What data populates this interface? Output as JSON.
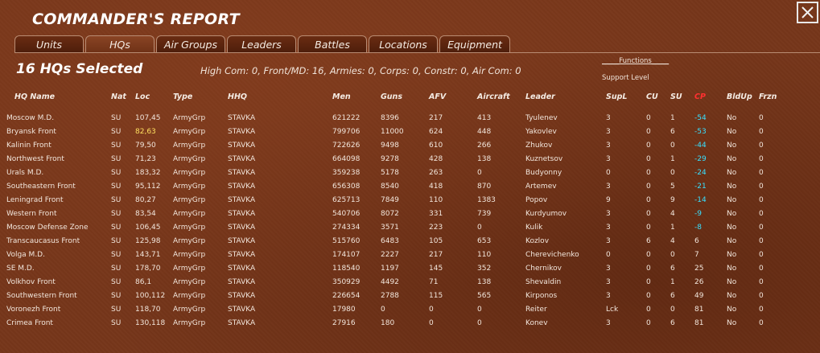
{
  "window": {
    "title": "COMMANDER'S REPORT",
    "close_label": "✕"
  },
  "tabs": [
    {
      "label": "Units",
      "active": false
    },
    {
      "label": "HQs",
      "active": true
    },
    {
      "label": "Air Groups",
      "active": false
    },
    {
      "label": "Leaders",
      "active": false
    },
    {
      "label": "Battles",
      "active": false
    },
    {
      "label": "Locations",
      "active": false
    },
    {
      "label": "Equipment",
      "active": false
    }
  ],
  "selection": {
    "title": "16 HQs Selected",
    "summary": "High Com: 0, Front/MD: 16, Armies: 0, Corps: 0, Constr: 0, Air Com: 0",
    "functions_label": "_____Functions_____",
    "support_level_label": "Support Level"
  },
  "columns": [
    "HQ Name",
    "Nat",
    "Loc",
    "Type",
    "HHQ",
    "Men",
    "Guns",
    "AFV",
    "Aircraft",
    "Leader",
    "SupL",
    "CU",
    "SU",
    "CP",
    "BldUp",
    "Frzn"
  ],
  "colors": {
    "cp_header": "#ff3030",
    "cp_negative": "#38e0ff",
    "highlight_loc": "#ffe060"
  },
  "rows": [
    {
      "name": "Moscow M.D.",
      "nat": "SU",
      "loc": "107,45",
      "type": "ArmyGrp",
      "hhq": "STAVKA",
      "men": "621222",
      "guns": "8396",
      "afv": "217",
      "aircraft": "413",
      "leader": "Tyulenev",
      "supl": "3",
      "cu": "0",
      "su": "1",
      "cp": "-54",
      "bldup": "No",
      "frzn": "0"
    },
    {
      "name": "Bryansk Front",
      "nat": "SU",
      "loc": "82,63",
      "loc_highlight": true,
      "type": "ArmyGrp",
      "hhq": "STAVKA",
      "men": "799706",
      "guns": "11000",
      "afv": "624",
      "aircraft": "448",
      "leader": "Yakovlev",
      "supl": "3",
      "cu": "0",
      "su": "6",
      "cp": "-53",
      "bldup": "No",
      "frzn": "0"
    },
    {
      "name": "Kalinin Front",
      "nat": "SU",
      "loc": "79,50",
      "type": "ArmyGrp",
      "hhq": "STAVKA",
      "men": "722626",
      "guns": "9498",
      "afv": "610",
      "aircraft": "266",
      "leader": "Zhukov",
      "supl": "3",
      "cu": "0",
      "su": "0",
      "cp": "-44",
      "bldup": "No",
      "frzn": "0"
    },
    {
      "name": "Northwest Front",
      "nat": "SU",
      "loc": "71,23",
      "type": "ArmyGrp",
      "hhq": "STAVKA",
      "men": "664098",
      "guns": "9278",
      "afv": "428",
      "aircraft": "138",
      "leader": "Kuznetsov",
      "supl": "3",
      "cu": "0",
      "su": "1",
      "cp": "-29",
      "bldup": "No",
      "frzn": "0"
    },
    {
      "name": "Urals M.D.",
      "nat": "SU",
      "loc": "183,32",
      "type": "ArmyGrp",
      "hhq": "STAVKA",
      "men": "359238",
      "guns": "5178",
      "afv": "263",
      "aircraft": "0",
      "leader": "Budyonny",
      "supl": "0",
      "cu": "0",
      "su": "0",
      "cp": "-24",
      "bldup": "No",
      "frzn": "0"
    },
    {
      "name": "Southeastern Front",
      "nat": "SU",
      "loc": "95,112",
      "type": "ArmyGrp",
      "hhq": "STAVKA",
      "men": "656308",
      "guns": "8540",
      "afv": "418",
      "aircraft": "870",
      "leader": "Artemev",
      "supl": "3",
      "cu": "0",
      "su": "5",
      "cp": "-21",
      "bldup": "No",
      "frzn": "0"
    },
    {
      "name": "Leningrad Front",
      "nat": "SU",
      "loc": "80,27",
      "type": "ArmyGrp",
      "hhq": "STAVKA",
      "men": "625713",
      "guns": "7849",
      "afv": "110",
      "aircraft": "1383",
      "leader": "Popov",
      "supl": "9",
      "cu": "0",
      "su": "9",
      "cp": "-14",
      "bldup": "No",
      "frzn": "0"
    },
    {
      "name": "Western Front",
      "nat": "SU",
      "loc": "83,54",
      "type": "ArmyGrp",
      "hhq": "STAVKA",
      "men": "540706",
      "guns": "8072",
      "afv": "331",
      "aircraft": "739",
      "leader": "Kurdyumov",
      "supl": "3",
      "cu": "0",
      "su": "4",
      "cp": "-9",
      "bldup": "No",
      "frzn": "0"
    },
    {
      "name": "Moscow Defense Zone",
      "nat": "SU",
      "loc": "106,45",
      "type": "ArmyGrp",
      "hhq": "STAVKA",
      "men": "274334",
      "guns": "3571",
      "afv": "223",
      "aircraft": "0",
      "leader": "Kulik",
      "supl": "3",
      "cu": "0",
      "su": "1",
      "cp": "-8",
      "bldup": "No",
      "frzn": "0"
    },
    {
      "name": "Transcaucasus Front",
      "nat": "SU",
      "loc": "125,98",
      "type": "ArmyGrp",
      "hhq": "STAVKA",
      "men": "515760",
      "guns": "6483",
      "afv": "105",
      "aircraft": "653",
      "leader": "Kozlov",
      "supl": "3",
      "cu": "6",
      "su": "4",
      "cp": "6",
      "bldup": "No",
      "frzn": "0"
    },
    {
      "name": "Volga M.D.",
      "nat": "SU",
      "loc": "143,71",
      "type": "ArmyGrp",
      "hhq": "STAVKA",
      "men": "174107",
      "guns": "2227",
      "afv": "217",
      "aircraft": "110",
      "leader": "Cherevichenko",
      "supl": "0",
      "cu": "0",
      "su": "0",
      "cp": "7",
      "bldup": "No",
      "frzn": "0"
    },
    {
      "name": "SE M.D.",
      "nat": "SU",
      "loc": "178,70",
      "type": "ArmyGrp",
      "hhq": "STAVKA",
      "men": "118540",
      "guns": "1197",
      "afv": "145",
      "aircraft": "352",
      "leader": "Chernikov",
      "supl": "3",
      "cu": "0",
      "su": "6",
      "cp": "25",
      "bldup": "No",
      "frzn": "0"
    },
    {
      "name": "Volkhov Front",
      "nat": "SU",
      "loc": "86,1",
      "type": "ArmyGrp",
      "hhq": "STAVKA",
      "men": "350929",
      "guns": "4492",
      "afv": "71",
      "aircraft": "138",
      "leader": "Shevaldin",
      "supl": "3",
      "cu": "0",
      "su": "1",
      "cp": "26",
      "bldup": "No",
      "frzn": "0"
    },
    {
      "name": "Southwestern Front",
      "nat": "SU",
      "loc": "100,112",
      "type": "ArmyGrp",
      "hhq": "STAVKA",
      "men": "226654",
      "guns": "2788",
      "afv": "115",
      "aircraft": "565",
      "leader": "Kirponos",
      "supl": "3",
      "cu": "0",
      "su": "6",
      "cp": "49",
      "bldup": "No",
      "frzn": "0"
    },
    {
      "name": "Voronezh Front",
      "nat": "SU",
      "loc": "118,70",
      "type": "ArmyGrp",
      "hhq": "STAVKA",
      "men": "17980",
      "guns": "0",
      "afv": "0",
      "aircraft": "0",
      "leader": "Reiter",
      "supl": "Lck",
      "cu": "0",
      "su": "0",
      "cp": "81",
      "bldup": "No",
      "frzn": "0"
    },
    {
      "name": "Crimea Front",
      "nat": "SU",
      "loc": "130,118",
      "type": "ArmyGrp",
      "hhq": "STAVKA",
      "men": "27916",
      "guns": "180",
      "afv": "0",
      "aircraft": "0",
      "leader": "Konev",
      "supl": "3",
      "cu": "0",
      "su": "6",
      "cp": "81",
      "bldup": "No",
      "frzn": "0"
    }
  ]
}
